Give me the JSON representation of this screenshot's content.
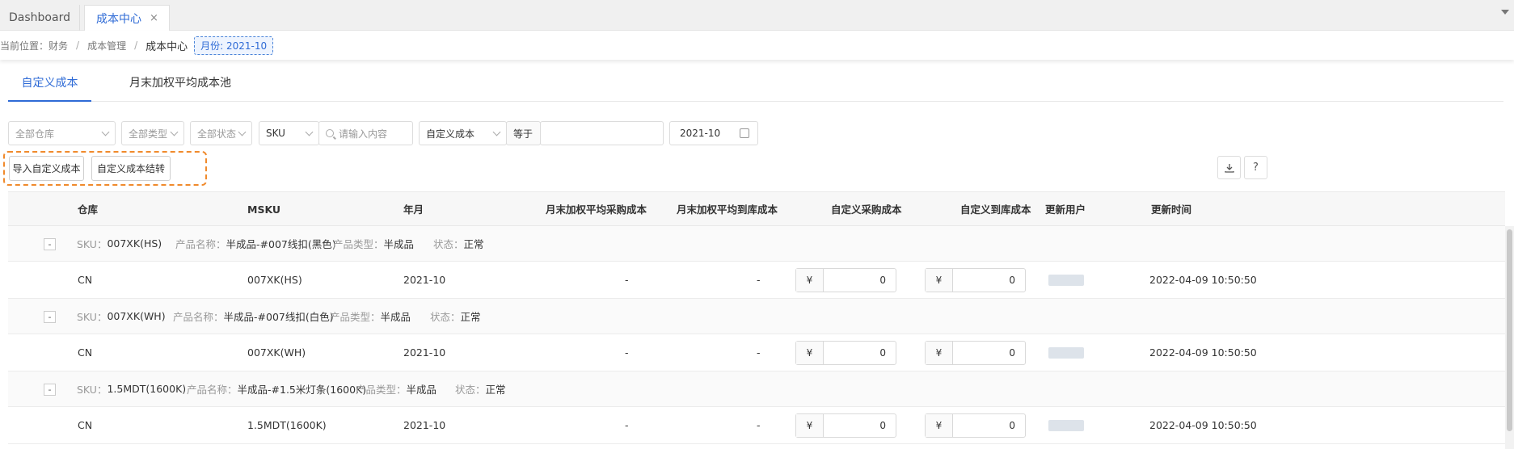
{
  "tabs": [
    {
      "label": "Dashboard",
      "active": false
    },
    {
      "label": "成本中心",
      "active": true,
      "close": "×"
    }
  ],
  "breadcrumb": {
    "prefix": "当前位置：财务",
    "sep": "/",
    "level2": "成本管理",
    "current": "成本中心",
    "month_tag": "月份: 2021-10"
  },
  "content_tabs": [
    "自定义成本",
    "月末加权平均成本池"
  ],
  "filters": {
    "warehouse": "全部仓库",
    "type": "全部类型",
    "status": "全部状态",
    "search_field": "SKU",
    "search_placeholder": "请输入内容",
    "cost_field": "自定义成本",
    "operator": "等于",
    "cost_value": "",
    "month": "2021-10"
  },
  "actions": {
    "import": "导入自定义成本",
    "carryover": "自定义成本结转",
    "export_icon": "download-icon",
    "help": "?"
  },
  "columns": [
    "仓库",
    "MSKU",
    "年月",
    "月末加权平均采购成本",
    "月末加权平均到库成本",
    "自定义采购成本",
    "自定义到库成本",
    "更新用户",
    "更新时间"
  ],
  "groups": [
    {
      "toggle": "-",
      "sku_label": "SKU：",
      "sku": "007XK(HS)",
      "name_label": "产品名称：",
      "name": "半成品-#007线扣(黑色)",
      "type_label": "产品类型：",
      "type": "半成品",
      "status_label": "状态：",
      "status": "正常",
      "row": {
        "warehouse": "CN",
        "msku": "007XK(HS)",
        "month": "2021-10",
        "avg_purchase": "-",
        "avg_arrival": "-",
        "currency": "¥",
        "custom_purchase": "0",
        "custom_arrival": "0",
        "updated_at": "2022-04-09 10:50:50"
      }
    },
    {
      "toggle": "-",
      "sku_label": "SKU：",
      "sku": "007XK(WH)",
      "name_label": "产品名称：",
      "name": "半成品-#007线扣(白色)",
      "type_label": "产品类型：",
      "type": "半成品",
      "status_label": "状态：",
      "status": "正常",
      "row": {
        "warehouse": "CN",
        "msku": "007XK(WH)",
        "month": "2021-10",
        "avg_purchase": "-",
        "avg_arrival": "-",
        "currency": "¥",
        "custom_purchase": "0",
        "custom_arrival": "0",
        "updated_at": "2022-04-09 10:50:50"
      }
    },
    {
      "toggle": "-",
      "sku_label": "SKU：",
      "sku": "1.5MDT(1600K)",
      "name_label": "产品名称：",
      "name": "半成品-#1.5米灯条(1600K)",
      "type_label": "产品类型：",
      "type": "半成品",
      "status_label": "状态：",
      "status": "正常",
      "row": {
        "warehouse": "CN",
        "msku": "1.5MDT(1600K)",
        "month": "2021-10",
        "avg_purchase": "-",
        "avg_arrival": "-",
        "currency": "¥",
        "custom_purchase": "0",
        "custom_arrival": "0",
        "updated_at": "2022-04-09 10:50:50"
      }
    }
  ],
  "colors": {
    "accent": "#2f6bd6",
    "highlight": "#f08a2c"
  }
}
